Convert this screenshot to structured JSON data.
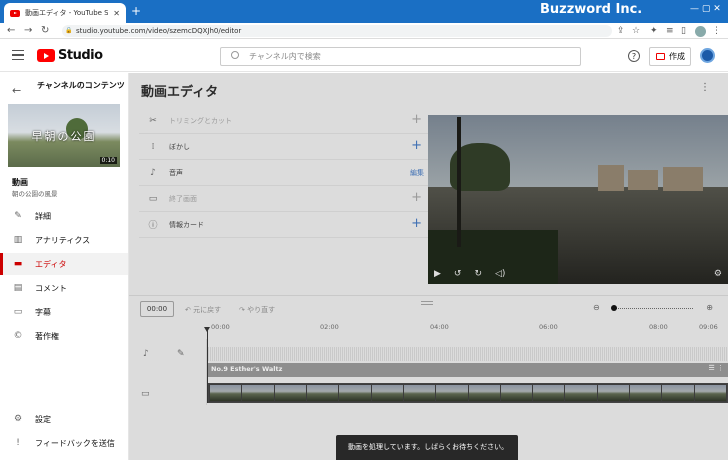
{
  "browser": {
    "tab_title": "動画エディタ - YouTube Studio",
    "new_tab": "+",
    "close": "✕",
    "url": "studio.youtube.com/video/szemcDQXJh0/editor",
    "profile_initials": "",
    "watermark": "Buzzword Inc."
  },
  "header": {
    "brand": "Studio",
    "search_placeholder": "チャンネル内で検索",
    "help": "?",
    "create_label": "作成"
  },
  "sidebar": {
    "title": "チャンネルのコンテンツ",
    "thumbnail_text": "早朝の公園",
    "thumbnail_duration": "0:10",
    "video_label": "動画",
    "video_name": "朝の公園の風景",
    "items": [
      {
        "label": "詳細",
        "icon": "pencil-icon"
      },
      {
        "label": "アナリティクス",
        "icon": "analytics-icon"
      },
      {
        "label": "エディタ",
        "icon": "editor-icon",
        "active": true
      },
      {
        "label": "コメント",
        "icon": "comment-icon"
      },
      {
        "label": "字幕",
        "icon": "subtitles-icon"
      },
      {
        "label": "著作権",
        "icon": "copyright-icon"
      }
    ],
    "bottom_items": [
      {
        "label": "設定",
        "icon": "gear-icon"
      },
      {
        "label": "フィードバックを送信",
        "icon": "feedback-icon"
      }
    ]
  },
  "editor": {
    "title": "動画エディタ",
    "tools": [
      {
        "label": "トリミングとカット",
        "action": "+",
        "disabled": true
      },
      {
        "label": "ぼかし",
        "action": "+"
      },
      {
        "label": "音声",
        "action": "編集"
      },
      {
        "label": "終了画面",
        "action": "+",
        "disabled": true
      },
      {
        "label": "情報カード",
        "action": "+"
      }
    ],
    "timecode": "00:00",
    "undo_label": "元に戻す",
    "redo_label": "やり直す",
    "ruler_ticks": [
      "00:00",
      "02:00",
      "04:00",
      "06:00",
      "08:00",
      "09:06"
    ],
    "audio_track_name": "No.9 Esther's Waltz"
  },
  "toast": "動画を処理しています。しばらくお待ちください。",
  "colors": {
    "accent_red": "#cc0000",
    "link_blue": "#3e6fb3",
    "chrome_blue": "#1a6fc4"
  }
}
